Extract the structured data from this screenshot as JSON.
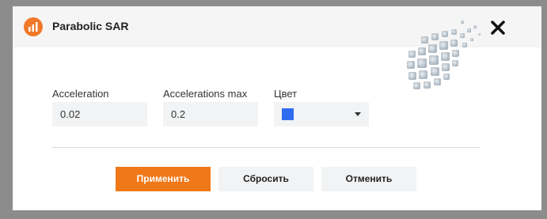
{
  "dialog": {
    "title": "Parabolic SAR",
    "icon": "indicator-chart-icon",
    "close_icon": "close-icon"
  },
  "fields": {
    "acceleration": {
      "label": "Acceleration",
      "value": "0.02"
    },
    "acceleration_max": {
      "label": "Accelerations max",
      "value": "0.2"
    },
    "color": {
      "label": "Цвет",
      "value_color": "#2f6cf0"
    }
  },
  "buttons": {
    "apply": "Применить",
    "reset": "Сбросить",
    "cancel": "Отменить"
  },
  "colors": {
    "accent": "#f07818",
    "swatch": "#2f6cf0"
  }
}
